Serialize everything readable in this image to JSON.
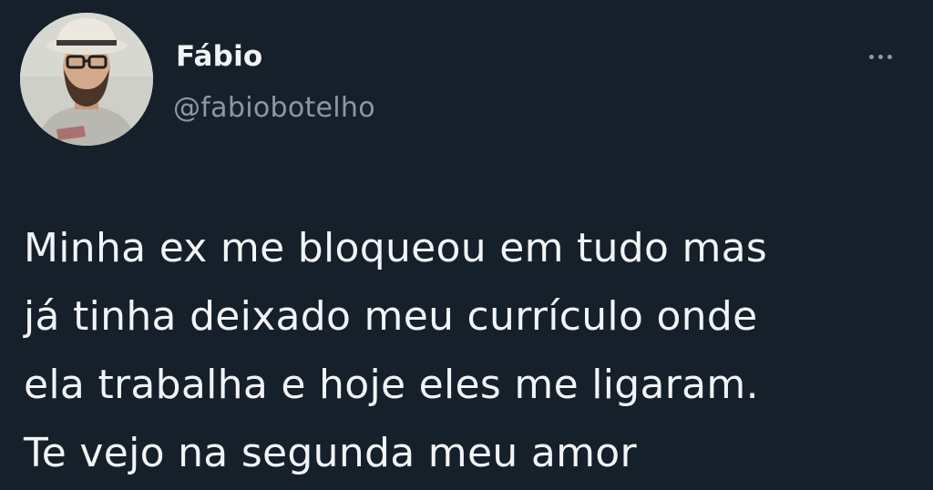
{
  "user": {
    "display_name": "Fábio",
    "handle": "@fabiobotelho",
    "avatar_icon": "user-avatar-photo"
  },
  "actions": {
    "more_icon": "more-horizontal-icon"
  },
  "tweet": {
    "lines": [
      "Minha ex me bloqueou em tudo mas",
      "já tinha deixado meu currículo onde",
      "ela trabalha e hoje eles me ligaram.",
      "Te vejo na segunda meu amor"
    ]
  },
  "colors": {
    "background": "#15202b",
    "primary_text": "#f2f4f5",
    "secondary_text": "#8b98a5"
  }
}
